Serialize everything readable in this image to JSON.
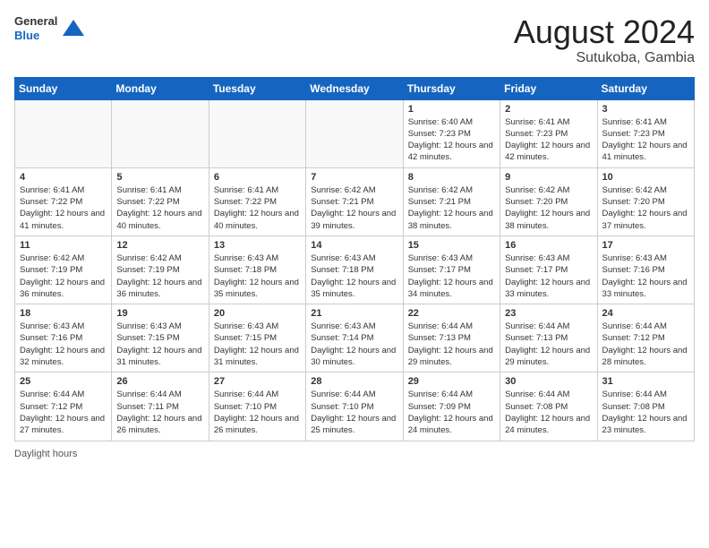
{
  "header": {
    "logo_general": "General",
    "logo_blue": "Blue",
    "month_year": "August 2024",
    "location": "Sutukoba, Gambia"
  },
  "columns": [
    "Sunday",
    "Monday",
    "Tuesday",
    "Wednesday",
    "Thursday",
    "Friday",
    "Saturday"
  ],
  "weeks": [
    [
      {
        "day": "",
        "info": ""
      },
      {
        "day": "",
        "info": ""
      },
      {
        "day": "",
        "info": ""
      },
      {
        "day": "",
        "info": ""
      },
      {
        "day": "1",
        "info": "Sunrise: 6:40 AM\nSunset: 7:23 PM\nDaylight: 12 hours and 42 minutes."
      },
      {
        "day": "2",
        "info": "Sunrise: 6:41 AM\nSunset: 7:23 PM\nDaylight: 12 hours and 42 minutes."
      },
      {
        "day": "3",
        "info": "Sunrise: 6:41 AM\nSunset: 7:23 PM\nDaylight: 12 hours and 41 minutes."
      }
    ],
    [
      {
        "day": "4",
        "info": "Sunrise: 6:41 AM\nSunset: 7:22 PM\nDaylight: 12 hours and 41 minutes."
      },
      {
        "day": "5",
        "info": "Sunrise: 6:41 AM\nSunset: 7:22 PM\nDaylight: 12 hours and 40 minutes."
      },
      {
        "day": "6",
        "info": "Sunrise: 6:41 AM\nSunset: 7:22 PM\nDaylight: 12 hours and 40 minutes."
      },
      {
        "day": "7",
        "info": "Sunrise: 6:42 AM\nSunset: 7:21 PM\nDaylight: 12 hours and 39 minutes."
      },
      {
        "day": "8",
        "info": "Sunrise: 6:42 AM\nSunset: 7:21 PM\nDaylight: 12 hours and 38 minutes."
      },
      {
        "day": "9",
        "info": "Sunrise: 6:42 AM\nSunset: 7:20 PM\nDaylight: 12 hours and 38 minutes."
      },
      {
        "day": "10",
        "info": "Sunrise: 6:42 AM\nSunset: 7:20 PM\nDaylight: 12 hours and 37 minutes."
      }
    ],
    [
      {
        "day": "11",
        "info": "Sunrise: 6:42 AM\nSunset: 7:19 PM\nDaylight: 12 hours and 36 minutes."
      },
      {
        "day": "12",
        "info": "Sunrise: 6:42 AM\nSunset: 7:19 PM\nDaylight: 12 hours and 36 minutes."
      },
      {
        "day": "13",
        "info": "Sunrise: 6:43 AM\nSunset: 7:18 PM\nDaylight: 12 hours and 35 minutes."
      },
      {
        "day": "14",
        "info": "Sunrise: 6:43 AM\nSunset: 7:18 PM\nDaylight: 12 hours and 35 minutes."
      },
      {
        "day": "15",
        "info": "Sunrise: 6:43 AM\nSunset: 7:17 PM\nDaylight: 12 hours and 34 minutes."
      },
      {
        "day": "16",
        "info": "Sunrise: 6:43 AM\nSunset: 7:17 PM\nDaylight: 12 hours and 33 minutes."
      },
      {
        "day": "17",
        "info": "Sunrise: 6:43 AM\nSunset: 7:16 PM\nDaylight: 12 hours and 33 minutes."
      }
    ],
    [
      {
        "day": "18",
        "info": "Sunrise: 6:43 AM\nSunset: 7:16 PM\nDaylight: 12 hours and 32 minutes."
      },
      {
        "day": "19",
        "info": "Sunrise: 6:43 AM\nSunset: 7:15 PM\nDaylight: 12 hours and 31 minutes."
      },
      {
        "day": "20",
        "info": "Sunrise: 6:43 AM\nSunset: 7:15 PM\nDaylight: 12 hours and 31 minutes."
      },
      {
        "day": "21",
        "info": "Sunrise: 6:43 AM\nSunset: 7:14 PM\nDaylight: 12 hours and 30 minutes."
      },
      {
        "day": "22",
        "info": "Sunrise: 6:44 AM\nSunset: 7:13 PM\nDaylight: 12 hours and 29 minutes."
      },
      {
        "day": "23",
        "info": "Sunrise: 6:44 AM\nSunset: 7:13 PM\nDaylight: 12 hours and 29 minutes."
      },
      {
        "day": "24",
        "info": "Sunrise: 6:44 AM\nSunset: 7:12 PM\nDaylight: 12 hours and 28 minutes."
      }
    ],
    [
      {
        "day": "25",
        "info": "Sunrise: 6:44 AM\nSunset: 7:12 PM\nDaylight: 12 hours and 27 minutes."
      },
      {
        "day": "26",
        "info": "Sunrise: 6:44 AM\nSunset: 7:11 PM\nDaylight: 12 hours and 26 minutes."
      },
      {
        "day": "27",
        "info": "Sunrise: 6:44 AM\nSunset: 7:10 PM\nDaylight: 12 hours and 26 minutes."
      },
      {
        "day": "28",
        "info": "Sunrise: 6:44 AM\nSunset: 7:10 PM\nDaylight: 12 hours and 25 minutes."
      },
      {
        "day": "29",
        "info": "Sunrise: 6:44 AM\nSunset: 7:09 PM\nDaylight: 12 hours and 24 minutes."
      },
      {
        "day": "30",
        "info": "Sunrise: 6:44 AM\nSunset: 7:08 PM\nDaylight: 12 hours and 24 minutes."
      },
      {
        "day": "31",
        "info": "Sunrise: 6:44 AM\nSunset: 7:08 PM\nDaylight: 12 hours and 23 minutes."
      }
    ]
  ],
  "footer": {
    "label": "Daylight hours"
  }
}
